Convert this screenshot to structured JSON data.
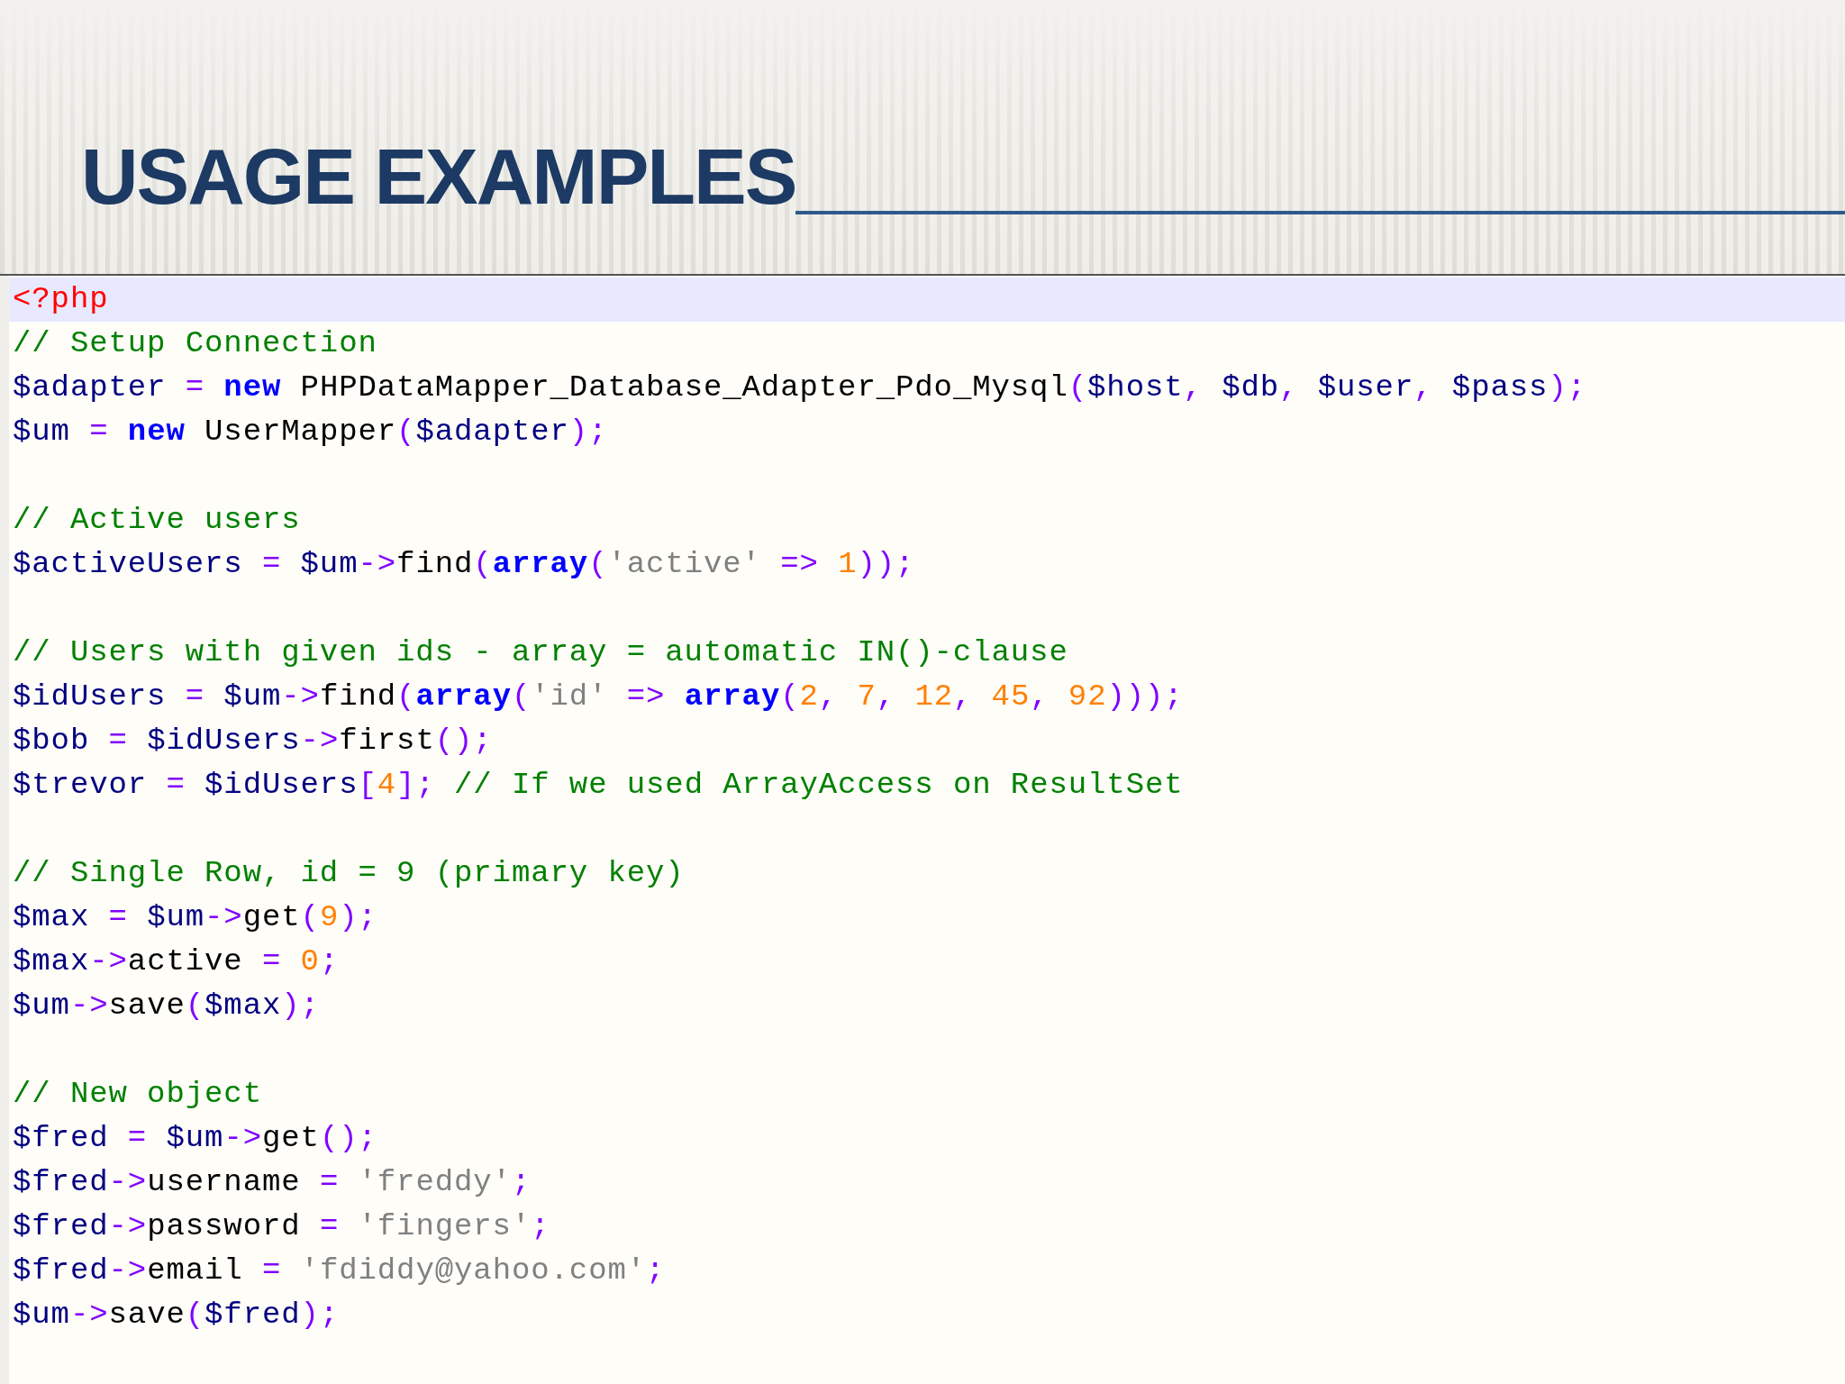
{
  "slide": {
    "title": "USAGE EXAMPLES"
  },
  "code": {
    "lines": [
      {
        "current": true,
        "tokens": [
          {
            "kind": "tag",
            "text": "<?php"
          }
        ]
      },
      {
        "current": false,
        "tokens": [
          {
            "kind": "comment",
            "text": "// Setup Connection"
          }
        ]
      },
      {
        "current": false,
        "tokens": [
          {
            "kind": "variable",
            "text": "$adapter"
          },
          {
            "kind": "operator",
            "text": " = "
          },
          {
            "kind": "keyword",
            "text": "new"
          },
          {
            "kind": "plain",
            "text": " PHPDataMapper_Database_Adapter_Pdo_Mysql"
          },
          {
            "kind": "operator",
            "text": "("
          },
          {
            "kind": "variable",
            "text": "$host"
          },
          {
            "kind": "operator",
            "text": ", "
          },
          {
            "kind": "variable",
            "text": "$db"
          },
          {
            "kind": "operator",
            "text": ", "
          },
          {
            "kind": "variable",
            "text": "$user"
          },
          {
            "kind": "operator",
            "text": ", "
          },
          {
            "kind": "variable",
            "text": "$pass"
          },
          {
            "kind": "operator",
            "text": ");"
          }
        ]
      },
      {
        "current": false,
        "tokens": [
          {
            "kind": "variable",
            "text": "$um"
          },
          {
            "kind": "operator",
            "text": " = "
          },
          {
            "kind": "keyword",
            "text": "new"
          },
          {
            "kind": "plain",
            "text": " UserMapper"
          },
          {
            "kind": "operator",
            "text": "("
          },
          {
            "kind": "variable",
            "text": "$adapter"
          },
          {
            "kind": "operator",
            "text": ");"
          }
        ]
      },
      {
        "current": false,
        "blank": true
      },
      {
        "current": false,
        "tokens": [
          {
            "kind": "comment",
            "text": "// Active users"
          }
        ]
      },
      {
        "current": false,
        "tokens": [
          {
            "kind": "variable",
            "text": "$activeUsers"
          },
          {
            "kind": "operator",
            "text": " = "
          },
          {
            "kind": "variable",
            "text": "$um"
          },
          {
            "kind": "operator",
            "text": "->"
          },
          {
            "kind": "plain",
            "text": "find"
          },
          {
            "kind": "operator",
            "text": "("
          },
          {
            "kind": "keyword",
            "text": "array"
          },
          {
            "kind": "operator",
            "text": "("
          },
          {
            "kind": "string",
            "text": "'active'"
          },
          {
            "kind": "operator",
            "text": " => "
          },
          {
            "kind": "number",
            "text": "1"
          },
          {
            "kind": "operator",
            "text": "));"
          }
        ]
      },
      {
        "current": false,
        "blank": true
      },
      {
        "current": false,
        "tokens": [
          {
            "kind": "comment",
            "text": "// Users with given ids - array = automatic IN()-clause"
          }
        ]
      },
      {
        "current": false,
        "tokens": [
          {
            "kind": "variable",
            "text": "$idUsers"
          },
          {
            "kind": "operator",
            "text": " = "
          },
          {
            "kind": "variable",
            "text": "$um"
          },
          {
            "kind": "operator",
            "text": "->"
          },
          {
            "kind": "plain",
            "text": "find"
          },
          {
            "kind": "operator",
            "text": "("
          },
          {
            "kind": "keyword",
            "text": "array"
          },
          {
            "kind": "operator",
            "text": "("
          },
          {
            "kind": "string",
            "text": "'id'"
          },
          {
            "kind": "operator",
            "text": " => "
          },
          {
            "kind": "keyword",
            "text": "array"
          },
          {
            "kind": "operator",
            "text": "("
          },
          {
            "kind": "number",
            "text": "2"
          },
          {
            "kind": "operator",
            "text": ", "
          },
          {
            "kind": "number",
            "text": "7"
          },
          {
            "kind": "operator",
            "text": ", "
          },
          {
            "kind": "number",
            "text": "12"
          },
          {
            "kind": "operator",
            "text": ", "
          },
          {
            "kind": "number",
            "text": "45"
          },
          {
            "kind": "operator",
            "text": ", "
          },
          {
            "kind": "number",
            "text": "92"
          },
          {
            "kind": "operator",
            "text": ")));"
          }
        ]
      },
      {
        "current": false,
        "tokens": [
          {
            "kind": "variable",
            "text": "$bob"
          },
          {
            "kind": "operator",
            "text": " = "
          },
          {
            "kind": "variable",
            "text": "$idUsers"
          },
          {
            "kind": "operator",
            "text": "->"
          },
          {
            "kind": "plain",
            "text": "first"
          },
          {
            "kind": "operator",
            "text": "();"
          }
        ]
      },
      {
        "current": false,
        "tokens": [
          {
            "kind": "variable",
            "text": "$trevor"
          },
          {
            "kind": "operator",
            "text": " = "
          },
          {
            "kind": "variable",
            "text": "$idUsers"
          },
          {
            "kind": "operator",
            "text": "["
          },
          {
            "kind": "number",
            "text": "4"
          },
          {
            "kind": "operator",
            "text": "]; "
          },
          {
            "kind": "comment",
            "text": "// If we used ArrayAccess on ResultSet"
          }
        ]
      },
      {
        "current": false,
        "blank": true
      },
      {
        "current": false,
        "tokens": [
          {
            "kind": "comment",
            "text": "// Single Row, id = 9 (primary key)"
          }
        ]
      },
      {
        "current": false,
        "tokens": [
          {
            "kind": "variable",
            "text": "$max"
          },
          {
            "kind": "operator",
            "text": " = "
          },
          {
            "kind": "variable",
            "text": "$um"
          },
          {
            "kind": "operator",
            "text": "->"
          },
          {
            "kind": "plain",
            "text": "get"
          },
          {
            "kind": "operator",
            "text": "("
          },
          {
            "kind": "number",
            "text": "9"
          },
          {
            "kind": "operator",
            "text": ");"
          }
        ]
      },
      {
        "current": false,
        "tokens": [
          {
            "kind": "variable",
            "text": "$max"
          },
          {
            "kind": "operator",
            "text": "->"
          },
          {
            "kind": "plain",
            "text": "active"
          },
          {
            "kind": "operator",
            "text": " = "
          },
          {
            "kind": "number",
            "text": "0"
          },
          {
            "kind": "operator",
            "text": ";"
          }
        ]
      },
      {
        "current": false,
        "tokens": [
          {
            "kind": "variable",
            "text": "$um"
          },
          {
            "kind": "operator",
            "text": "->"
          },
          {
            "kind": "plain",
            "text": "save"
          },
          {
            "kind": "operator",
            "text": "("
          },
          {
            "kind": "variable",
            "text": "$max"
          },
          {
            "kind": "operator",
            "text": ");"
          }
        ]
      },
      {
        "current": false,
        "blank": true
      },
      {
        "current": false,
        "tokens": [
          {
            "kind": "comment",
            "text": "// New object"
          }
        ]
      },
      {
        "current": false,
        "tokens": [
          {
            "kind": "variable",
            "text": "$fred"
          },
          {
            "kind": "operator",
            "text": " = "
          },
          {
            "kind": "variable",
            "text": "$um"
          },
          {
            "kind": "operator",
            "text": "->"
          },
          {
            "kind": "plain",
            "text": "get"
          },
          {
            "kind": "operator",
            "text": "();"
          }
        ]
      },
      {
        "current": false,
        "tokens": [
          {
            "kind": "variable",
            "text": "$fred"
          },
          {
            "kind": "operator",
            "text": "->"
          },
          {
            "kind": "plain",
            "text": "username"
          },
          {
            "kind": "operator",
            "text": " = "
          },
          {
            "kind": "string",
            "text": "'freddy'"
          },
          {
            "kind": "operator",
            "text": ";"
          }
        ]
      },
      {
        "current": false,
        "tokens": [
          {
            "kind": "variable",
            "text": "$fred"
          },
          {
            "kind": "operator",
            "text": "->"
          },
          {
            "kind": "plain",
            "text": "password"
          },
          {
            "kind": "operator",
            "text": " = "
          },
          {
            "kind": "string",
            "text": "'fingers'"
          },
          {
            "kind": "operator",
            "text": ";"
          }
        ]
      },
      {
        "current": false,
        "tokens": [
          {
            "kind": "variable",
            "text": "$fred"
          },
          {
            "kind": "operator",
            "text": "->"
          },
          {
            "kind": "plain",
            "text": "email"
          },
          {
            "kind": "operator",
            "text": " = "
          },
          {
            "kind": "string",
            "text": "'fdiddy@yahoo.com'"
          },
          {
            "kind": "operator",
            "text": ";"
          }
        ]
      },
      {
        "current": false,
        "tokens": [
          {
            "kind": "variable",
            "text": "$um"
          },
          {
            "kind": "operator",
            "text": "->"
          },
          {
            "kind": "plain",
            "text": "save"
          },
          {
            "kind": "operator",
            "text": "("
          },
          {
            "kind": "variable",
            "text": "$fred"
          },
          {
            "kind": "operator",
            "text": ");"
          }
        ]
      }
    ]
  }
}
